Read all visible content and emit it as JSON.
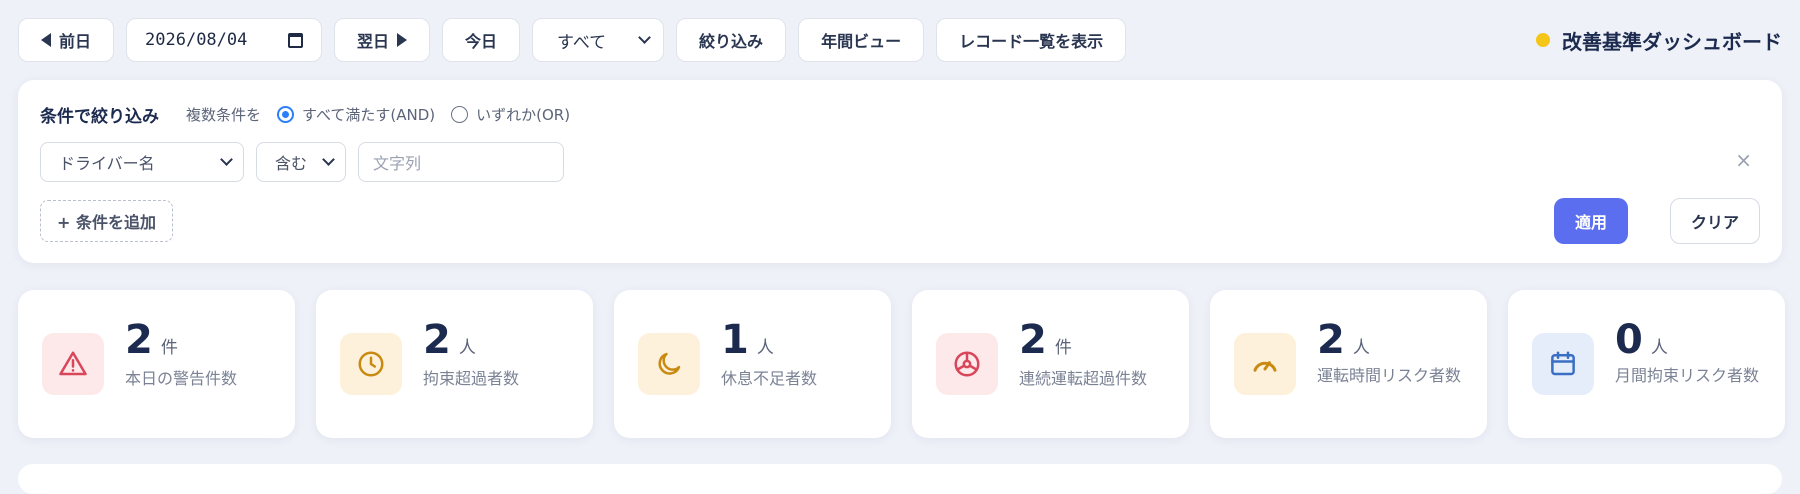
{
  "toolbar": {
    "prev_label": "前日",
    "date_value": "2026/08/04",
    "next_label": "翌日",
    "today_label": "今日",
    "scope_value": "すべて",
    "filter_label": "絞り込み",
    "year_view_label": "年間ビュー",
    "records_label": "レコード一覧を表示"
  },
  "brand": {
    "title": "改善基準ダッシュボード",
    "dot_color": "#f5c518"
  },
  "filter": {
    "title": "条件で絞り込み",
    "mode_prefix": "複数条件を",
    "mode_and": "すべて満たす(AND)",
    "mode_or": "いずれか(OR)",
    "field_value": "ドライバー名",
    "operator_value": "含む",
    "text_placeholder": "文字列",
    "close_symbol": "×",
    "add_condition": "+ 条件を追加",
    "apply_label": "適用",
    "clear_label": "クリア"
  },
  "cards": [
    {
      "value": "2",
      "unit": "件",
      "label": "本日の警告件数",
      "icon": "warning-triangle-icon",
      "color": "#d9465a"
    },
    {
      "value": "2",
      "unit": "人",
      "label": "拘束超過者数",
      "icon": "clock-icon",
      "color": "#c98a12"
    },
    {
      "value": "1",
      "unit": "人",
      "label": "休息不足者数",
      "icon": "moon-icon",
      "color": "#c98a12"
    },
    {
      "value": "2",
      "unit": "件",
      "label": "連続運転超過件数",
      "icon": "steering-wheel-icon",
      "color": "#d9465a"
    },
    {
      "value": "2",
      "unit": "人",
      "label": "運転時間リスク者数",
      "icon": "gauge-icon",
      "color": "#c98a12"
    },
    {
      "value": "0",
      "unit": "人",
      "label": "月間拘束リスク者数",
      "icon": "calendar-icon",
      "color": "#3b6fc4"
    }
  ]
}
